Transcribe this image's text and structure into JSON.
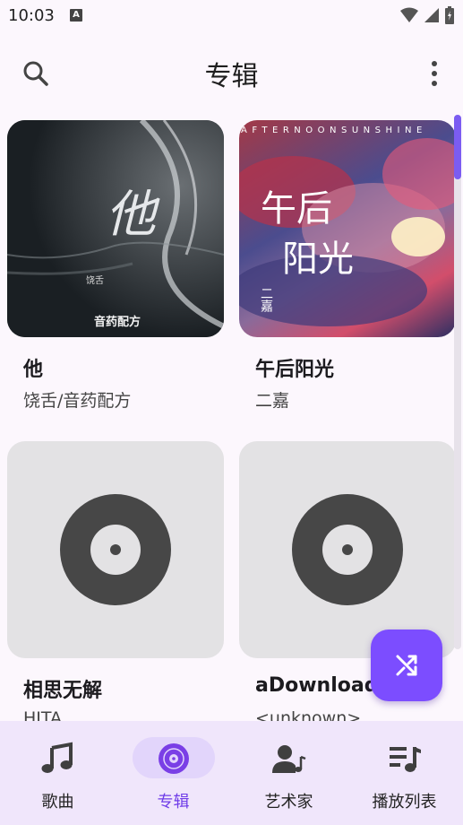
{
  "status_bar": {
    "time": "10:03",
    "notification_icon": "A"
  },
  "app_bar": {
    "title": "专辑",
    "search_icon": "search-icon",
    "more_icon": "more-vert-icon"
  },
  "albums": [
    {
      "title": "他",
      "subtitle": "饶舌/音药配方",
      "cover": "image",
      "cover_text": "他",
      "cover_artist": "饶舌",
      "cover_label": "音药配方"
    },
    {
      "title": "午后阳光",
      "subtitle": "二嘉",
      "cover": "image",
      "cover_text_1": "午后",
      "cover_text_2": "阳光",
      "cover_banner": "AFTERNOONSUNSHINE",
      "cover_artist": "二嘉"
    },
    {
      "title": "相思无解",
      "subtitle": "HITA",
      "cover": "placeholder-disc-icon"
    },
    {
      "title": "aDownload",
      "subtitle": "<unknown>",
      "cover": "placeholder-disc-icon"
    }
  ],
  "fab": {
    "icon": "shuffle-icon"
  },
  "nav": [
    {
      "label": "歌曲",
      "icon": "music-note-icon",
      "active": false
    },
    {
      "label": "专辑",
      "icon": "album-icon",
      "active": true
    },
    {
      "label": "艺术家",
      "icon": "artist-icon",
      "active": false
    },
    {
      "label": "播放列表",
      "icon": "playlist-icon",
      "active": false
    }
  ],
  "colors": {
    "accent": "#7c4dff",
    "background": "#fcf7fd",
    "nav_background": "#f0e6fb",
    "placeholder": "#e3e2e4",
    "disc": "#474747"
  }
}
